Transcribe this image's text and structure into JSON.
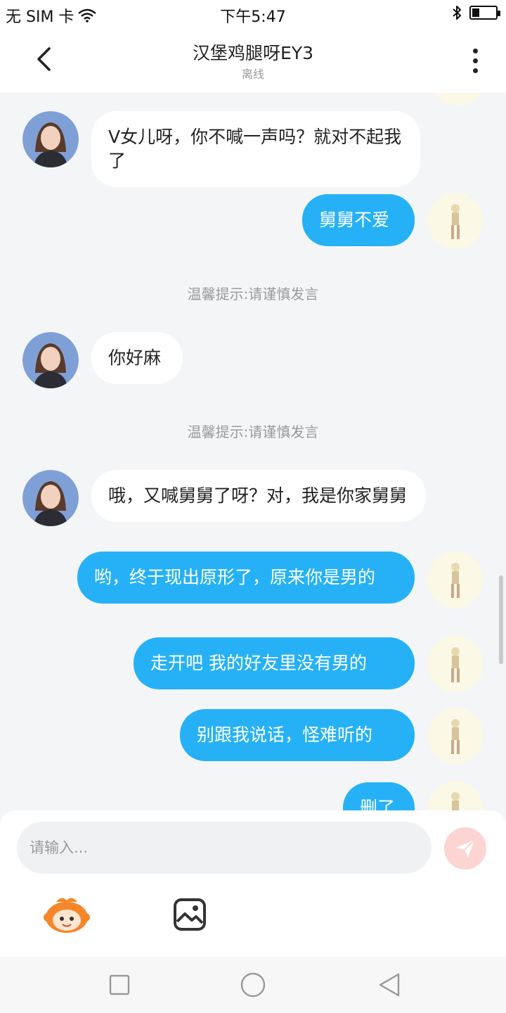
{
  "status_bar": {
    "carrier": "无 SIM 卡",
    "time": "下午5:47",
    "battery_level": 0.3
  },
  "header": {
    "title": "汉堡鸡腿呀EY3",
    "subtitle": "离线"
  },
  "messages": [
    {
      "side": "in",
      "text": "V女儿呀，你不喊一声吗？就对不起我了"
    },
    {
      "side": "out",
      "text": "舅舅不爱"
    },
    {
      "side": "notice",
      "text": "温馨提示:请谨慎发言"
    },
    {
      "side": "in",
      "text": "你好麻"
    },
    {
      "side": "notice",
      "text": "温馨提示:请谨慎发言"
    },
    {
      "side": "in",
      "text": "哦，又喊舅舅了呀？对，我是你家舅舅"
    },
    {
      "side": "out",
      "text": "哟，终于现出原形了，原来你是男的"
    },
    {
      "side": "out",
      "text": "走开吧 我的好友里没有男的"
    },
    {
      "side": "out",
      "text": "别跟我说话，怪难听的"
    },
    {
      "side": "out",
      "text": "删了"
    }
  ],
  "composer": {
    "placeholder": "请输入..."
  },
  "colors": {
    "accent": "#26b1f6",
    "send_disabled": "#fcd4d2",
    "send_arrow": "#ffffff"
  },
  "icons": {
    "back": "chevron-left-icon",
    "more": "more-vertical-icon",
    "send": "send-icon",
    "emoji": "emoji-mascot-icon",
    "image": "image-icon"
  }
}
